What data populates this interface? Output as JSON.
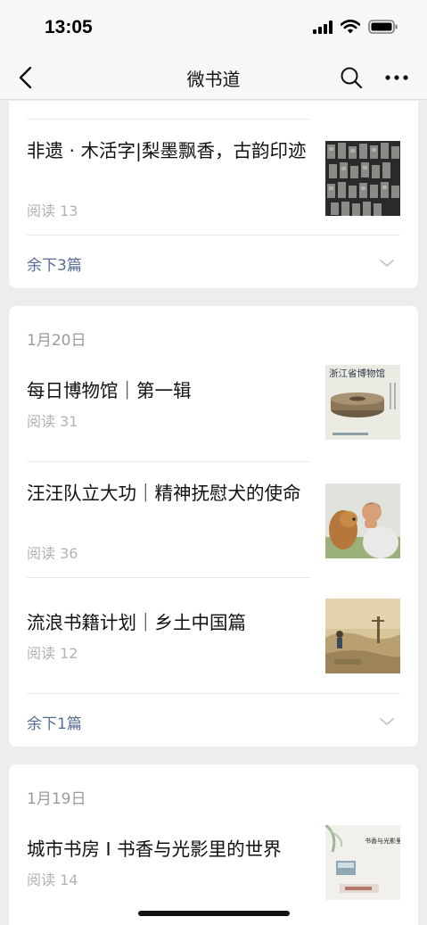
{
  "status_bar": {
    "time": "13:05"
  },
  "nav": {
    "title": "微书道",
    "back_icon": "chevron-left-icon",
    "search_icon": "search-icon",
    "more_icon": "more-icon"
  },
  "groups": [
    {
      "articles": [
        {
          "title": "非遗 · 木活字|梨墨飘香，古韵印迹",
          "reads": "阅读 13",
          "thumb": "movable-type-blocks"
        }
      ],
      "more": "余下3篇"
    },
    {
      "date": "1月20日",
      "articles": [
        {
          "title": "每日博物馆｜第一辑",
          "reads": "阅读 31",
          "thumb": "museum-book-cover",
          "thumb_text": "浙江省博物馆"
        },
        {
          "title": "汪汪队立大功｜精神抚慰犬的使命",
          "reads": "阅读 36",
          "thumb": "man-with-dog"
        },
        {
          "title": "流浪书籍计划｜乡土中国篇",
          "reads": "阅读 12",
          "thumb": "rural-painting"
        }
      ],
      "more": "余下1篇"
    },
    {
      "date": "1月19日",
      "articles": [
        {
          "title": "城市书房 I 书香与光影里的世界",
          "reads": "阅读 14",
          "thumb": "book-poster",
          "thumb_text": "书香与光影里的世界"
        }
      ]
    }
  ],
  "colors": {
    "link": "#576b95",
    "muted": "#b2b2b2",
    "date": "#9a9a9a",
    "background": "#ededed"
  }
}
